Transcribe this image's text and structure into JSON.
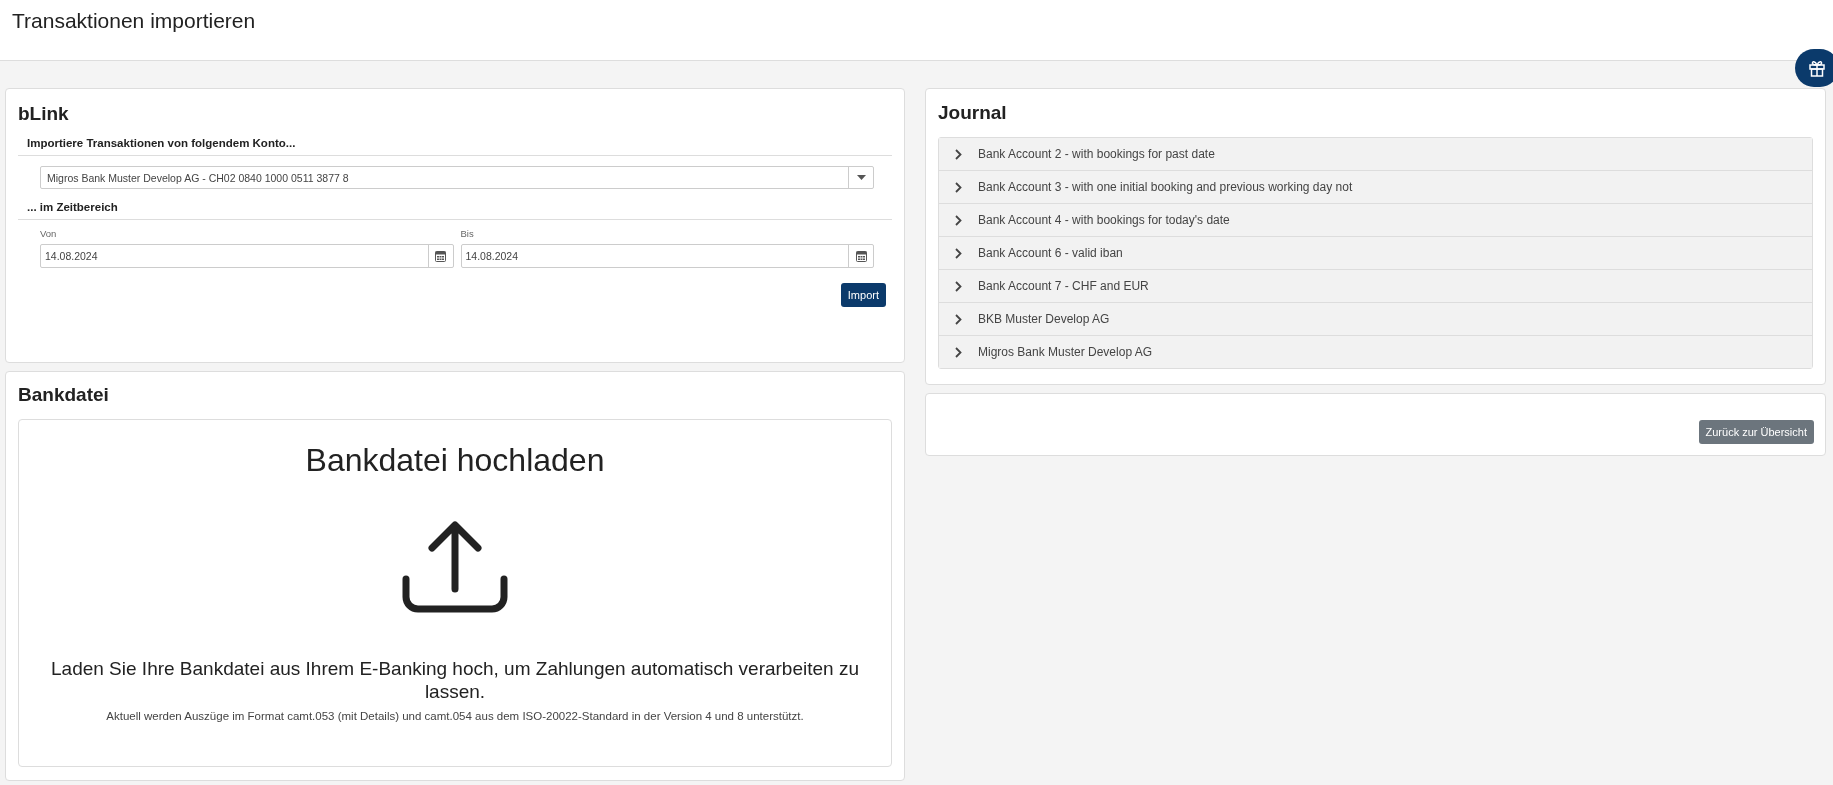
{
  "page_title": "Transaktionen importieren",
  "blink": {
    "title": "bLink",
    "account_heading": "Importiere Transaktionen von folgendem Konto...",
    "account_select": {
      "value": "Migros Bank Muster Develop AG - CH02 0840 1000 0511 3877 8"
    },
    "range_heading": "... im Zeitbereich",
    "from": {
      "label": "Von",
      "value": "14.08.2024"
    },
    "to": {
      "label": "Bis",
      "value": "14.08.2024"
    },
    "import_button": "Import"
  },
  "bankdatei": {
    "title": "Bankdatei",
    "upload_title": "Bankdatei hochladen",
    "upload_text": "Laden Sie Ihre Bankdatei aus Ihrem E-Banking hoch, um Zahlungen automatisch verarbeiten zu lassen.",
    "upload_note": "Aktuell werden Auszüge im Format camt.053 (mit Details) und camt.054 aus dem ISO-20022-Standard in der Version 4 und 8 unterstützt."
  },
  "journal": {
    "title": "Journal",
    "items": [
      {
        "label": "Bank Account 2 - with bookings for past date",
        "expanded": false
      },
      {
        "label": "Bank Account 3 - with one initial booking and previous working day not",
        "expanded": false
      },
      {
        "label": "Bank Account 4 - with bookings for today's date",
        "expanded": false
      },
      {
        "label": "Bank Account 6 - valid iban",
        "expanded": false
      },
      {
        "label": "Bank Account 7 - CHF and EUR",
        "expanded": false
      },
      {
        "label": "BKB Muster Develop AG",
        "expanded": false
      },
      {
        "label": "Migros Bank Muster Develop AG",
        "expanded": false
      }
    ]
  },
  "back_button": "Zurück zur Übersicht"
}
